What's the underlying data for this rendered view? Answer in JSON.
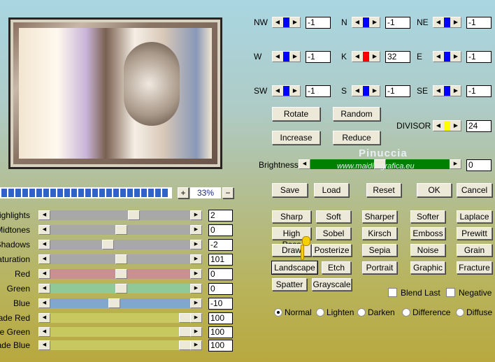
{
  "kernel": [
    {
      "label": "NW",
      "value": "-1",
      "color": "#0000ff"
    },
    {
      "label": "N",
      "value": "-1",
      "color": "#0000ff"
    },
    {
      "label": "NE",
      "value": "-1",
      "color": "#0000ff"
    },
    {
      "label": "W",
      "value": "-1",
      "color": "#0000ff"
    },
    {
      "label": "K",
      "value": "32",
      "color": "#ff0000"
    },
    {
      "label": "E",
      "value": "-1",
      "color": "#0000ff"
    },
    {
      "label": "SW",
      "value": "-1",
      "color": "#0000ff"
    },
    {
      "label": "S",
      "value": "-1",
      "color": "#0000ff"
    },
    {
      "label": "SE",
      "value": "-1",
      "color": "#0000ff"
    }
  ],
  "buttons": {
    "rotate": "Rotate",
    "random": "Random",
    "increase": "Increase",
    "reduce": "Reduce",
    "save": "Save",
    "load": "Load",
    "reset": "Reset",
    "ok": "OK",
    "cancel": "Cancel"
  },
  "divisor": {
    "label": "DIVISOR",
    "value": "24",
    "color": "#ffff00"
  },
  "brightness": {
    "label": "Brightness",
    "value": "0",
    "color": "#008000"
  },
  "watermark": {
    "name": "Pinuccia",
    "url": "www.maidiregrafica.eu"
  },
  "zoom": {
    "plus": "+",
    "value": "33%",
    "minus": "−"
  },
  "sliders": [
    {
      "label": "Highlights",
      "value": "2"
    },
    {
      "label": "Midtones",
      "value": "0"
    },
    {
      "label": "Shadows",
      "value": "-2"
    },
    {
      "label": "Saturation",
      "value": "101"
    },
    {
      "label": "Red",
      "value": "0"
    },
    {
      "label": "Green",
      "value": "0"
    },
    {
      "label": "Blue",
      "value": "-10"
    },
    {
      "label": "Fade Red",
      "value": "100"
    },
    {
      "label": "Fade Green",
      "value": "100"
    },
    {
      "label": "Fade Blue",
      "value": "100"
    }
  ],
  "filters": [
    "Sharp",
    "Soft",
    "Sharper",
    "Softer",
    "Laplace",
    "High Pass",
    "Sobel",
    "Kirsch",
    "Emboss",
    "Prewitt",
    "Draw",
    "Posterize",
    "Sepia",
    "Noise",
    "Grain",
    "Landscape",
    "Etch",
    "Portrait",
    "Graphic",
    "Fracture",
    "Spatter",
    "Grayscale"
  ],
  "checkboxes": [
    {
      "label": "Blend Last",
      "checked": false
    },
    {
      "label": "Negative",
      "checked": false
    }
  ],
  "modes": [
    {
      "label": "Normal",
      "selected": true
    },
    {
      "label": "Lighten"
    },
    {
      "label": "Darken"
    },
    {
      "label": "Difference"
    },
    {
      "label": "Diffuse"
    }
  ]
}
